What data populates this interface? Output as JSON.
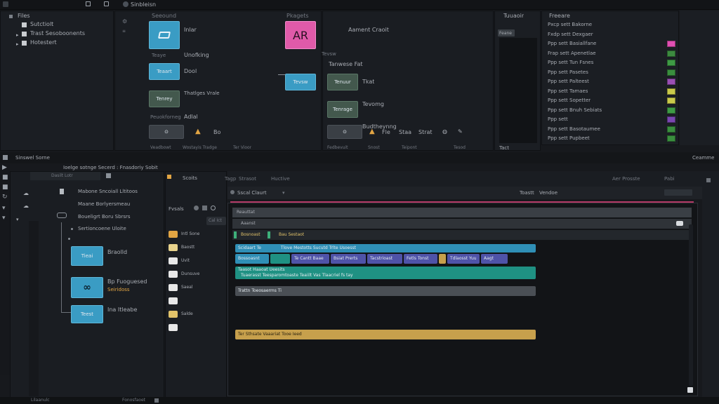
{
  "topbar": {
    "tab1": "Sinbleisn",
    "tab2": ""
  },
  "tree": {
    "header": "Files",
    "items": [
      "Sutctiolt",
      "Trast Sesoboonents",
      "Hotestert"
    ]
  },
  "nodes": {
    "left_col_header": "Seeound",
    "right_col_header": "Pkagets",
    "left": [
      {
        "tile": "",
        "label": "Inlar"
      },
      {
        "tile": "Teaye",
        "label": "Unofking"
      },
      {
        "tile": "Teaart",
        "label": "Dool"
      },
      {
        "tile": "Tenrey",
        "label": "Thatlges Vrale"
      },
      {
        "tile": "",
        "label": "Adlal"
      }
    ],
    "left_sub": "Peuokforneg",
    "left_footer": [
      "Veadbowt",
      "Wostayis Tradge",
      "Ter Vioor"
    ],
    "right": [
      {
        "tile": "AR",
        "label": "Aament Craoit"
      },
      {
        "tile": "Tevsw",
        "label": "Tanwese Fat"
      },
      {
        "tile": "Tenuur",
        "label": "Tkat"
      },
      {
        "tile": "Tenrage",
        "label": "Tevomg"
      },
      {
        "tile": "",
        "label": "Budtheynng"
      }
    ],
    "right_footer": [
      "Fedbevuit",
      "Snost",
      "Teipont",
      "Tesod"
    ],
    "right_tools": [
      "Fle",
      "Staa",
      "Strat"
    ]
  },
  "properties": {
    "left_header": "Tuuaoir",
    "right_header": "Freeare",
    "left_item": "Feane",
    "left_footer": "Tact",
    "rows": [
      {
        "label": "Pxcp sett Bakorne",
        "color": ""
      },
      {
        "label": "Fxdp sett Dexgaer",
        "color": ""
      },
      {
        "label": "Ppp sett Basiallfane",
        "color": "#e04fb2"
      },
      {
        "label": "Frap sett Apenetlae",
        "color": "#3c8a3f"
      },
      {
        "label": "Ppp sett Tun Fsnes",
        "color": "#3e9a44"
      },
      {
        "label": "Ppp sett Pasetes",
        "color": "#3a8e3e"
      },
      {
        "label": "Ppp sett Palteest",
        "color": "#9a4fb4"
      },
      {
        "label": "Ppp sett Tamaes",
        "color": "#c9c94a"
      },
      {
        "label": "Ppp sett Sopetter",
        "color": "#c9c94a"
      },
      {
        "label": "Ppp sett Bnuh Sebiats",
        "color": "#3e9a44"
      },
      {
        "label": "Ppp sett",
        "color": "#7a46b0"
      },
      {
        "label": "Ppp sett Basotaumee",
        "color": "#3a8e3e"
      },
      {
        "label": "Ppp sett Pupbeet",
        "color": "#3a8e3e"
      }
    ]
  },
  "lower": {
    "panel_tab": "Sinswel Sorne",
    "header_title": "Ioelge sotnge Secerd : Fnasdoriy Sobit",
    "right_tab": "Ceamme",
    "left_col_tab": "Dasilt Lotr",
    "tree_items": [
      "Mabone Sncoiall Lltitoos",
      "Maane Borlyersmeau",
      "Boueligrt Boru Sbrsrs",
      "Sertioncoene Uloite"
    ],
    "node_blocks": [
      {
        "tile": "Tieai",
        "label": "Braolld",
        "sub": ""
      },
      {
        "tile": "",
        "label": "Bp Fuoguesed",
        "sub": "Seiridoss"
      },
      {
        "tile": "Teest",
        "label": "Ina Itleabe",
        "sub": ""
      }
    ],
    "assets_header": "Fvsals",
    "assets_search": "Cal Ict",
    "folders": [
      "Intl Sone",
      "Baostt",
      "Uvit",
      "Dunsuve",
      "Saeal",
      "",
      "Salde",
      ""
    ],
    "timeline_tab": "Scoits",
    "timeline_toolbar": [
      "Tagp",
      "Strasot",
      "Huctive"
    ],
    "timeline_right": [
      "Aer Prosste",
      "Pabi"
    ],
    "timeline_sub": "Sscal Claurt",
    "timeline_sub_right": [
      "Toastt",
      "Vendoe"
    ],
    "seq_header": "Reauttat",
    "seq_row": "Aaanst",
    "seq_markers": [
      "Bosnoast",
      "Bau Sestaot"
    ],
    "track1_label": "Scidaart Te",
    "track1_header": "Tlove Mestotts Sucutd Trlte Usoesst",
    "track1_clips": [
      "Bossoasnt",
      "",
      "Te Cantt Baae",
      "Bsiat Prerts",
      "Tacstrioast",
      "Fetls Tonst",
      "",
      "Tdlaosst Yuu",
      "Aagt"
    ],
    "track2_label": "Taasot Haaoat Ueesits",
    "track2_header": "Tuaerasst Teesparomtoaste Teaiilt Vas Tlaacriel fs tay",
    "track3_label": "Trattn Toeosaerms  Ti",
    "track4_label": "Ter Sthsate Vaaariat Tooe  Ieed",
    "footer_left": "Lilaanulc",
    "footer_mid": "Fonosfaoet"
  },
  "colors": {
    "track_blue": "#2f8fb6",
    "track_purple": "#4f53a8",
    "track_teal": "#1f9183",
    "track_gray": "#4a4f55",
    "track_gold": "#c7a04c"
  }
}
